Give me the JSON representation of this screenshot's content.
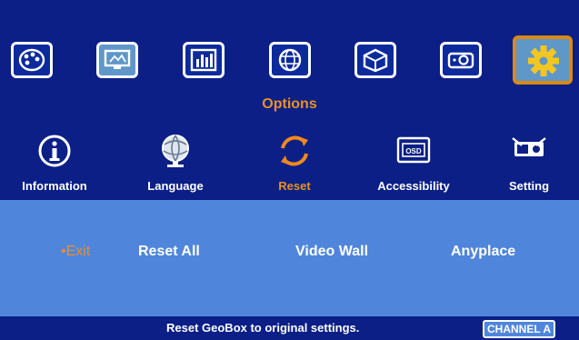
{
  "top_menu": [
    {
      "icon": "palette-icon"
    },
    {
      "icon": "monitor-icon",
      "active": true
    },
    {
      "icon": "equalizer-icon"
    },
    {
      "icon": "globe-icon"
    },
    {
      "icon": "3d-cube-icon"
    },
    {
      "icon": "projector-icon"
    },
    {
      "icon": "gear-icon",
      "selected": true
    }
  ],
  "page_title": "Options",
  "sub_menu": [
    {
      "label": "Information",
      "icon": "info-icon"
    },
    {
      "label": "Language",
      "icon": "globe-icon"
    },
    {
      "label": "Reset",
      "icon": "reset-icon",
      "selected": true
    },
    {
      "label": "Accessibility",
      "icon": "osd-icon"
    },
    {
      "label": "Setting",
      "icon": "projector-setting-icon"
    }
  ],
  "options": [
    {
      "label": "Exit",
      "selected": true
    },
    {
      "label": "Reset All"
    },
    {
      "label": "Video Wall"
    },
    {
      "label": "Anyplace"
    }
  ],
  "status": {
    "message": "Reset GeoBox to original settings.",
    "channel": "CHANNEL A"
  },
  "colors": {
    "background": "#0b1f86",
    "panel": "#4f86db",
    "accent": "#e59126",
    "selected_frame": "#d88a14"
  }
}
